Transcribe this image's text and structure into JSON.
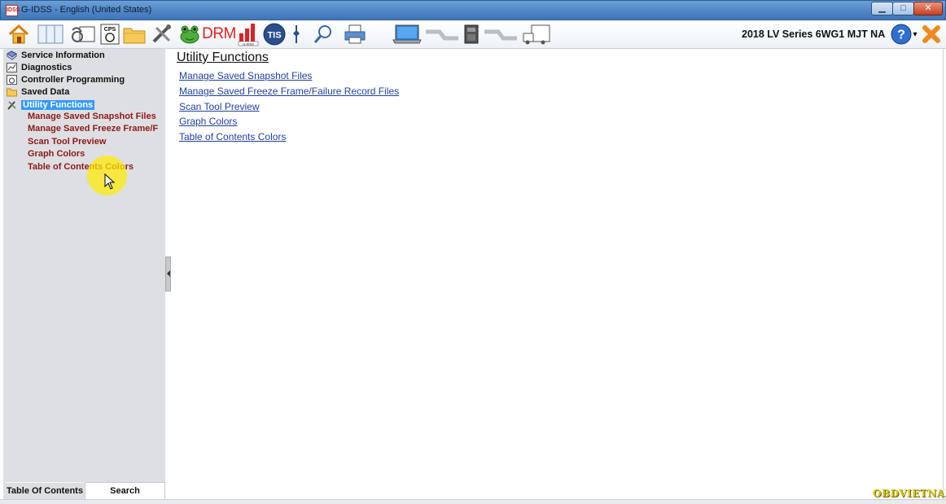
{
  "window": {
    "title": "G-IDSS - English (United States)",
    "app_icon_text": "IDSS",
    "minimize_glyph": "▁",
    "maximize_glyph": "□",
    "close_glyph": "✕"
  },
  "toolbar": {
    "icons": [
      "home-icon",
      "panel-icon",
      "diagnostics-icon",
      "cps-icon",
      "folder-icon",
      "tools-icon",
      "frog-icon",
      "drm-icon",
      "graph-icon",
      "tis-icon",
      "pin-icon",
      "magnifier-icon",
      "printer-icon",
      "laptop-icon",
      "connection-icon",
      "device-icon",
      "connection-icon",
      "vehicle-interface-icon",
      "help-icon",
      "exit-icon"
    ],
    "cps_label": "CPS",
    "drm_label": "DRM",
    "graph_caption": "G-IDSS",
    "tis_label": "TIS",
    "vehicle_info": "2018 LV Series 6WG1 MJT NA",
    "help_glyph": "?",
    "dropdown_glyph": "▾"
  },
  "sidebar": {
    "tree": [
      {
        "label": "Service Information",
        "icon": "book-icon"
      },
      {
        "label": "Diagnostics",
        "icon": "chart-icon"
      },
      {
        "label": "Controller Programming",
        "icon": "programming-icon"
      },
      {
        "label": "Saved Data",
        "icon": "folder-icon"
      },
      {
        "label": "Utility Functions",
        "icon": "tools-icon",
        "selected": true
      }
    ],
    "utility_children": [
      "Manage Saved Snapshot Files",
      "Manage Saved Freeze Frame/F",
      "Scan Tool Preview",
      "Graph Colors",
      "Table of Contents Colors"
    ],
    "tabs": [
      "Table Of Contents",
      "Search"
    ],
    "active_tab": "Table Of Contents"
  },
  "main": {
    "title": "Utility Functions",
    "links": [
      "Manage Saved Snapshot Files",
      "Manage Saved Freeze Frame/Failure Record Files",
      "Scan Tool Preview",
      "Graph Colors",
      "Table of Contents Colors"
    ]
  },
  "watermark": "OBDVIETNAM",
  "colors": {
    "selection": "#3399ff",
    "child_text": "#8b1a1a",
    "link": "#1f3f9e",
    "sidebar_bg": "#dedfe2"
  }
}
